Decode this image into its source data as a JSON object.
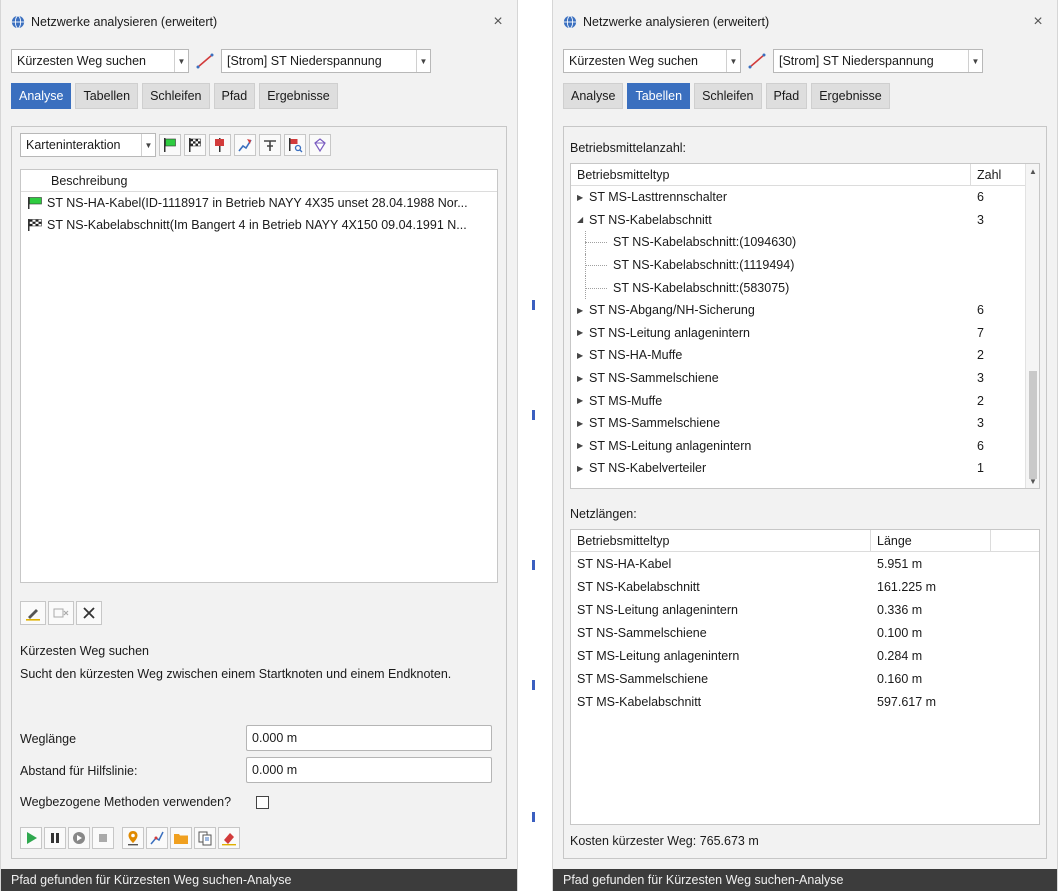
{
  "left": {
    "title": "Netzwerke analysieren (erweitert)",
    "close_glyph": "×",
    "mode_select": "Kürzesten Weg suchen",
    "network_select": "[Strom] ST Niederspannung",
    "tabs": [
      {
        "label": "Analyse",
        "active": true
      },
      {
        "label": "Tabellen",
        "active": false
      },
      {
        "label": "Schleifen",
        "active": false
      },
      {
        "label": "Pfad",
        "active": false
      },
      {
        "label": "Ergebnisse",
        "active": false
      }
    ],
    "interaction_select": "Karteninteraktion",
    "list_header": "Beschreibung",
    "list_rows": [
      {
        "icon": "green-flag-icon",
        "text": "ST NS-HA-Kabel(ID-1118917 in Betrieb NAYY 4X35 unset 28.04.1988 Nor..."
      },
      {
        "icon": "checkered-flag-icon",
        "text": "ST NS-Kabelabschnitt(Im Bangert 4 in Betrieb NAYY 4X150 09.04.1991 N..."
      }
    ],
    "tool_name": "Kürzesten Weg suchen",
    "tool_description": "Sucht den kürzesten Weg zwischen einem Startknoten und einem Endknoten.",
    "fields": [
      {
        "label": "Weglänge",
        "value": "0.000 m"
      },
      {
        "label": "Abstand für Hilfslinie:",
        "value": "0.000 m"
      }
    ],
    "checkbox_label": "Wegbezogene Methoden verwenden?",
    "checkbox_checked": false,
    "status": "Pfad gefunden für Kürzesten Weg suchen-Analyse"
  },
  "right": {
    "title": "Netzwerke analysieren (erweitert)",
    "close_glyph": "×",
    "mode_select": "Kürzesten Weg suchen",
    "network_select": "[Strom] ST Niederspannung",
    "tabs": [
      {
        "label": "Analyse",
        "active": false
      },
      {
        "label": "Tabellen",
        "active": true
      },
      {
        "label": "Schleifen",
        "active": false
      },
      {
        "label": "Pfad",
        "active": false
      },
      {
        "label": "Ergebnisse",
        "active": false
      }
    ],
    "count_section_label": "Betriebsmittelanzahl:",
    "count_headers": [
      "Betriebsmitteltyp",
      "Zahl"
    ],
    "count_rows": [
      {
        "type": "ST MS-Lasttrennschalter",
        "count": "6",
        "expander": "▶",
        "child": false
      },
      {
        "type": "ST NS-Kabelabschnitt",
        "count": "3",
        "expander": "◢",
        "child": false
      },
      {
        "type": "ST NS-Kabelabschnitt:(1094630)",
        "count": "",
        "expander": "",
        "child": true
      },
      {
        "type": "ST NS-Kabelabschnitt:(1119494)",
        "count": "",
        "expander": "",
        "child": true
      },
      {
        "type": "ST NS-Kabelabschnitt:(583075)",
        "count": "",
        "expander": "",
        "child": true
      },
      {
        "type": "ST NS-Abgang/NH-Sicherung",
        "count": "6",
        "expander": "▶",
        "child": false
      },
      {
        "type": "ST NS-Leitung anlagenintern",
        "count": "7",
        "expander": "▶",
        "child": false
      },
      {
        "type": "ST NS-HA-Muffe",
        "count": "2",
        "expander": "▶",
        "child": false
      },
      {
        "type": "ST NS-Sammelschiene",
        "count": "3",
        "expander": "▶",
        "child": false
      },
      {
        "type": "ST MS-Muffe",
        "count": "2",
        "expander": "▶",
        "child": false
      },
      {
        "type": "ST MS-Sammelschiene",
        "count": "3",
        "expander": "▶",
        "child": false
      },
      {
        "type": "ST MS-Leitung anlagenintern",
        "count": "6",
        "expander": "▶",
        "child": false
      },
      {
        "type": "ST NS-Kabelverteiler",
        "count": "1",
        "expander": "▶",
        "child": false
      }
    ],
    "length_section_label": "Netzlängen:",
    "length_headers": [
      "Betriebsmitteltyp",
      "Länge"
    ],
    "length_rows": [
      {
        "type": "ST NS-HA-Kabel",
        "length": "5.951 m"
      },
      {
        "type": "ST NS-Kabelabschnitt",
        "length": "161.225 m"
      },
      {
        "type": "ST NS-Leitung anlagenintern",
        "length": "0.336 m"
      },
      {
        "type": "ST NS-Sammelschiene",
        "length": "0.100 m"
      },
      {
        "type": "ST MS-Leitung anlagenintern",
        "length": "0.284 m"
      },
      {
        "type": "ST MS-Sammelschiene",
        "length": "0.160 m"
      },
      {
        "type": "ST MS-Kabelabschnitt",
        "length": "597.617 m"
      }
    ],
    "cost_text": "Kosten kürzester Weg: 765.673 m",
    "status": "Pfad gefunden für Kürzesten Weg suchen-Analyse"
  },
  "colors": {
    "accent": "#3a6fbf",
    "status_bar": "#3c3c3c",
    "play_green": "#2fa84f",
    "flag_green": "#2ecc40",
    "pin_red": "#d23b3b",
    "folder_orange": "#f0a020"
  }
}
